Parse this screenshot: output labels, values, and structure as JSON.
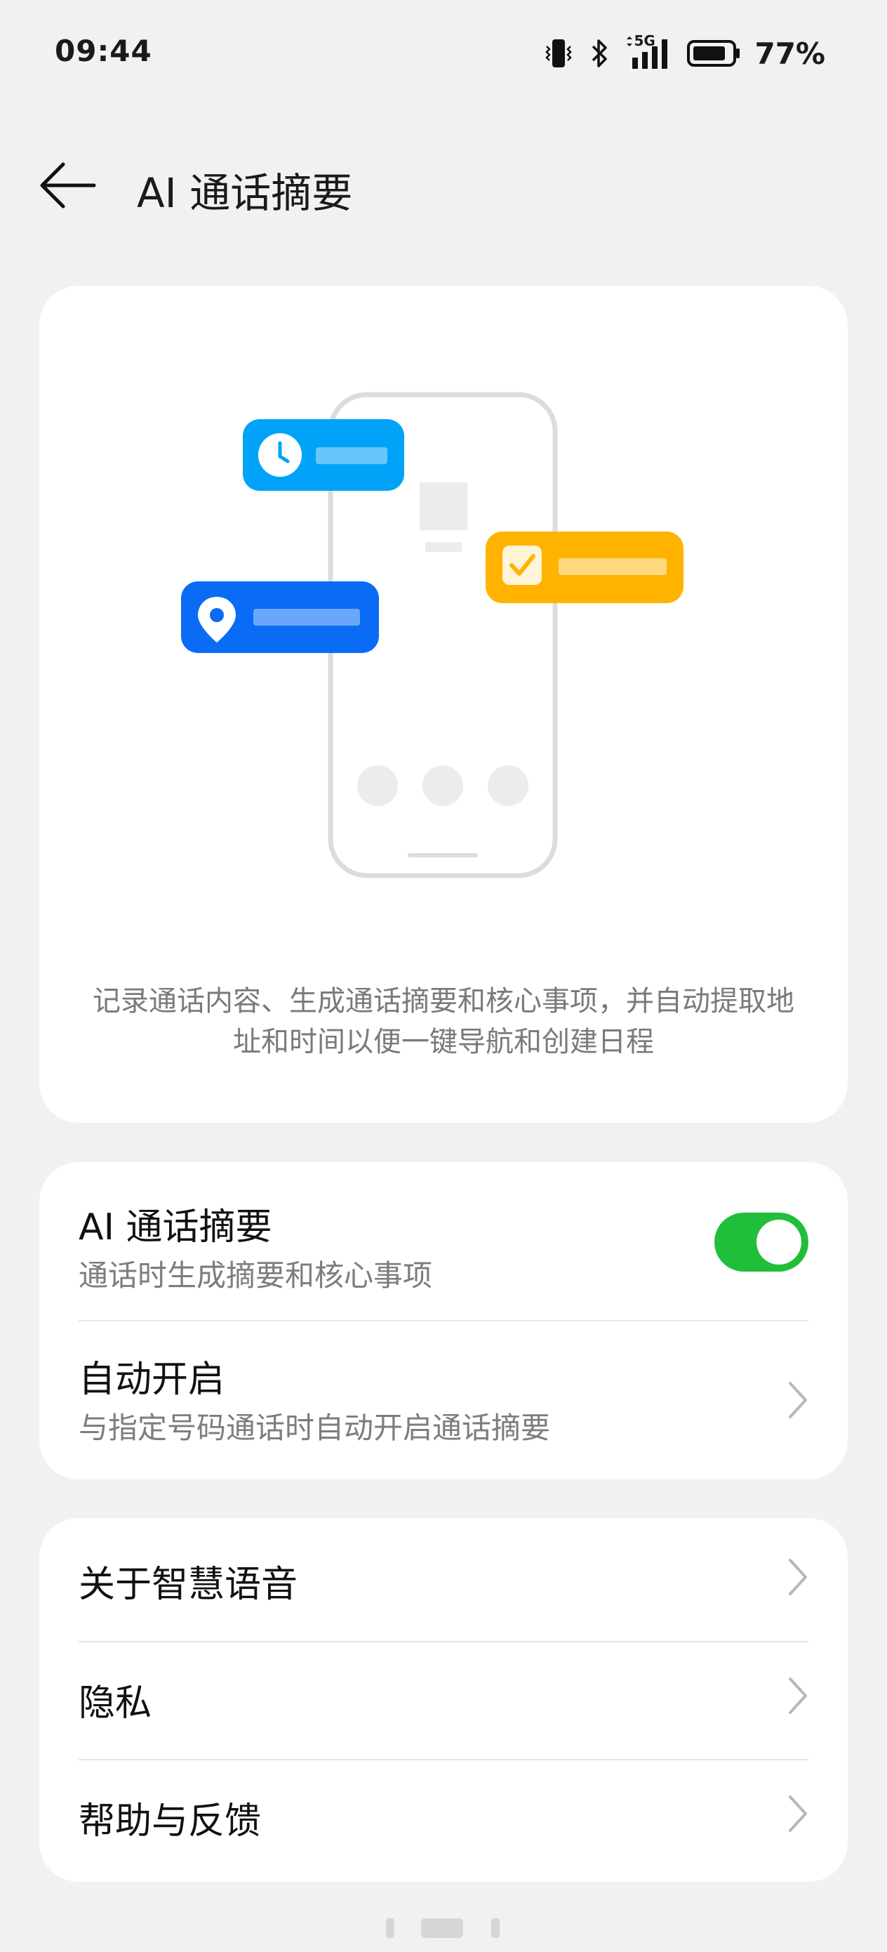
{
  "status_bar": {
    "time": "09:44",
    "network": "5G",
    "battery": "77%",
    "icons": [
      "vibrate-icon",
      "bluetooth-icon",
      "signal-icon",
      "battery-icon"
    ]
  },
  "header": {
    "title": "AI 通话摘要",
    "back_icon": "back-arrow-icon"
  },
  "hero": {
    "description": "记录通话内容、生成通话摘要和核心事项，并自动提取地址和时间以便一键导航和创建日程",
    "illustration_icons": [
      "clock-icon",
      "location-icon",
      "checkbox-icon",
      "phone-outline-icon"
    ]
  },
  "settings": {
    "ai_summary": {
      "title": "AI 通话摘要",
      "subtitle": "通话时生成摘要和核心事项",
      "enabled": true
    },
    "auto_start": {
      "title": "自动开启",
      "subtitle": "与指定号码通话时自动开启通话摘要"
    }
  },
  "links": [
    {
      "label": "关于智慧语音"
    },
    {
      "label": "隐私"
    },
    {
      "label": "帮助与反馈"
    }
  ],
  "colors": {
    "accent_green": "#1fbf3a",
    "blue_light": "#00a3f7",
    "blue_dark": "#0a6cf5",
    "amber": "#ffb300",
    "background": "#f1f1f3"
  }
}
